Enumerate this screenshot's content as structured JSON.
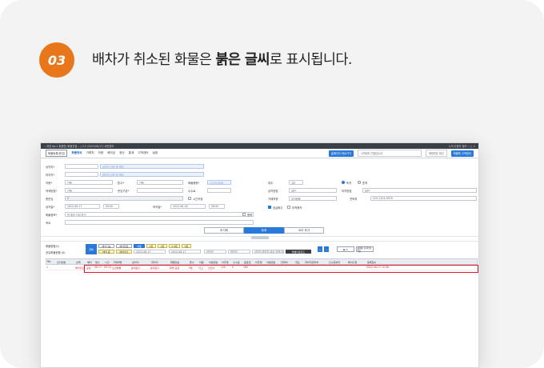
{
  "step": {
    "number": "03"
  },
  "headline": {
    "before": "배차가 취소된 화물은 ",
    "bold": "붉은 글씨",
    "after": "로 표시됩니다."
  },
  "titlebar": {
    "left": "…포장 No.1 화물맨 (화물연결 …) 3.5 (2022/06/17) 버전정보",
    "right": "누적 사용자 정보 ─ □ ✕"
  },
  "menubar": {
    "register_btn": "화물등록(운임)",
    "items": [
      "화물정보",
      "거래처",
      "차량",
      "배차금",
      "정산",
      "통계",
      "고객센터",
      "설정"
    ],
    "right_blue": "홈페이지 바로가기",
    "right_box": "고객센터 연결입니다",
    "right_search": "회원번호 확인",
    "right_btn": "화물맨 고객센터"
  },
  "form": {
    "labels": {
      "shipper": "상차지*",
      "receiver": "하차지*",
      "cartype": "차종*",
      "loadmethod": "적재방법*",
      "load_status": "총운임",
      "loaddate": "상차일*",
      "goods": "화물정보*",
      "memo": "적요",
      "unloaddate": "하차일*",
      "tonnage": "톤수*",
      "weight": "화물중량*",
      "pay_type": "운임구분*",
      "fee": "수수료",
      "carrier": "대수",
      "cust_type": "상차방법",
      "unload_method": "하차방법",
      "payer": "거래처명",
      "phone": "연락처",
      "time_opt": "시간지정"
    },
    "placeholders": {
      "shipper": "상차지 입력 후 엔터",
      "receiver": "하차지 입력 후 엔터",
      "weight": "(1.5% 이내)",
      "goods": "한 포장 단위 표기"
    },
    "values": {
      "cartype": "선택",
      "tonnage": "선택",
      "loadmethod": "선택",
      "load_status": "0",
      "loaddate": "2022-06-17",
      "loadtime": "09:00",
      "unloaddate": "2022-06-18",
      "unloadtime": "06:00",
      "carrier_count": "1대",
      "radio1": "독차",
      "radio2": "혼적",
      "cust_type": "일반",
      "unload_method": "일반",
      "payer": "오션화물",
      "phone": "010-1234-5678",
      "chk_a": "공급화주",
      "chk_b": "미적용자",
      "goods_extra": "왕복"
    }
  },
  "actions": {
    "reset": "초기화",
    "submit": "등록",
    "add": "요이 추가"
  },
  "list": {
    "title": "화물현황(1)",
    "filter_label": "공유화물현황 (0)",
    "btn1": "전체",
    "btn2": "배차가능",
    "btn3": "배차완료",
    "btn4": "배차 중",
    "btn5": "배차취소",
    "date_from": "2022-06-17",
    "date_to": "2022-06-17",
    "tags": [
      "차종",
      "1톤",
      "1톤",
      "2.5톤",
      "5톤"
    ],
    "search_ph1": "상차지",
    "search_ph2": "하차지",
    "search_ph3": "상차지,하차지,비고,입력(검색어)",
    "search_btn": "조회",
    "dark_btn": "엑셀다운로드",
    "plus": "+",
    "minus": "−",
    "play_count": "▶ 4",
    "stop": "■",
    "settings": "컬럼 조회/설정"
  },
  "table": {
    "columns": [
      "No.",
      "오더번호",
      "상태",
      "배차",
      "접수",
      "시간",
      "거래처명",
      "상차지",
      "하차지",
      "화물정보",
      "톤수",
      "차종",
      "차량번호",
      "차주명",
      "수수료",
      "총운임",
      "차주명",
      "차량번호",
      "연락처",
      "적요",
      "하차지연락처",
      "인수증처리",
      "특이사항",
      "등록일시"
    ],
    "rows": [
      [
        "1",
        "",
        "배차취소",
        "공유",
        "06-17",
        "09:14",
        "오션화물",
        "동대문구",
        "동대문구",
        "화학 공장",
        "5톤",
        "카고",
        "인천사",
        "120",
        "0",
        "180",
        "",
        "",
        "",
        "",
        "",
        "",
        "",
        "2022-06-17 10:06"
      ]
    ]
  },
  "colors": {
    "accent": "#e8771b",
    "cancel_red": "#d6192a",
    "blue": "#2a79d8"
  }
}
